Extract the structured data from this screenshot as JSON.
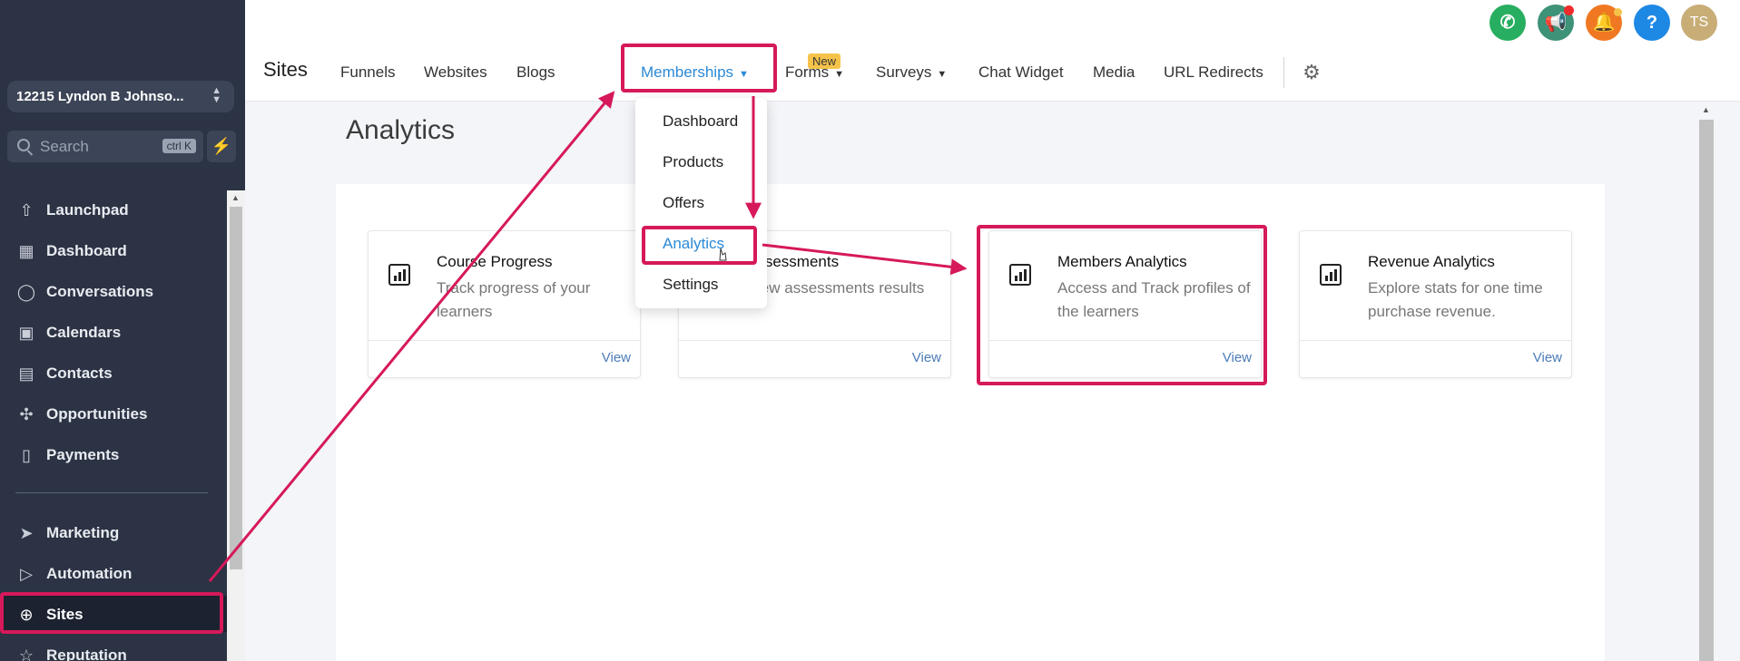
{
  "sidebar": {
    "location": "12215 Lyndon B Johnso...",
    "search_placeholder": "Search",
    "search_shortcut": "ctrl K",
    "items": [
      {
        "label": "Launchpad",
        "icon": "rocket-icon"
      },
      {
        "label": "Dashboard",
        "icon": "grid-icon"
      },
      {
        "label": "Conversations",
        "icon": "chat-icon"
      },
      {
        "label": "Calendars",
        "icon": "calendar-icon"
      },
      {
        "label": "Contacts",
        "icon": "contacts-icon"
      },
      {
        "label": "Opportunities",
        "icon": "network-icon"
      },
      {
        "label": "Payments",
        "icon": "receipt-icon"
      },
      {
        "label": "Marketing",
        "icon": "send-icon"
      },
      {
        "label": "Automation",
        "icon": "play-icon"
      },
      {
        "label": "Sites",
        "icon": "globe-icon"
      },
      {
        "label": "Reputation",
        "icon": "star-icon"
      }
    ]
  },
  "header": {
    "title": "Sites",
    "tabs": [
      "Funnels",
      "Websites",
      "Blogs",
      "Memberships",
      "Forms",
      "Surveys",
      "Chat Widget",
      "Media",
      "URL Redirects"
    ],
    "new_badge": "New",
    "avatar": "TS"
  },
  "dropdown": {
    "items": [
      "Dashboard",
      "Products",
      "Offers",
      "Analytics",
      "Settings"
    ],
    "selected": "Analytics"
  },
  "main": {
    "title": "Analytics",
    "cards": [
      {
        "title": "Course Progress",
        "desc": "Track progress of your learners",
        "view": "View"
      },
      {
        "title": "Assessments",
        "desc": "View assessments results",
        "view": "View"
      },
      {
        "title": "Members Analytics",
        "desc": "Access and Track profiles of the learners",
        "view": "View"
      },
      {
        "title": "Revenue Analytics",
        "desc": "Explore stats for one time purchase revenue.",
        "view": "View"
      }
    ]
  },
  "colors": {
    "accent": "#2b89d6",
    "annotation": "#d6195a",
    "sidebar": "#2b3344"
  }
}
